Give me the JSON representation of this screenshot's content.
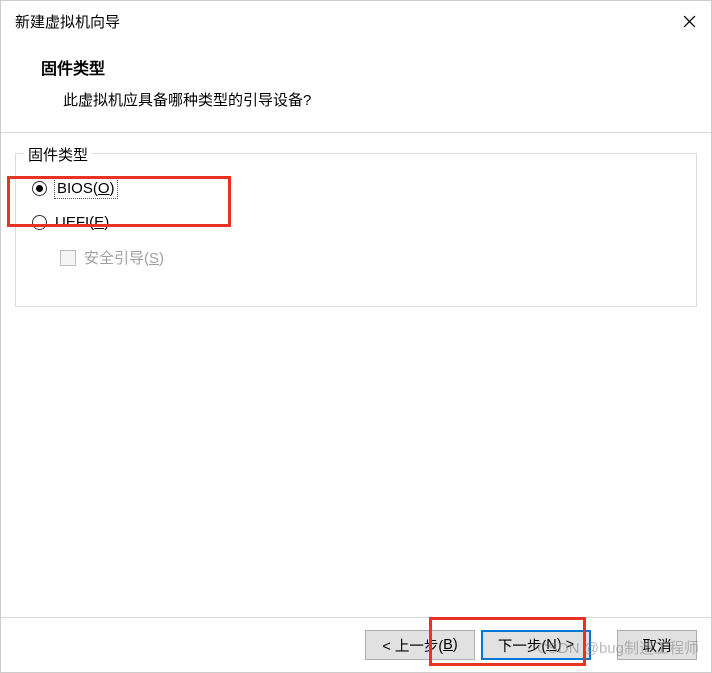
{
  "window": {
    "title": "新建虚拟机向导"
  },
  "header": {
    "heading": "固件类型",
    "subtext": "此虚拟机应具备哪种类型的引导设备?"
  },
  "group": {
    "legend": "固件类型",
    "options": {
      "bios": {
        "prefix": "BIOS(",
        "hotkey": "O",
        "suffix": ")",
        "selected": true
      },
      "uefi": {
        "prefix": "UEFI(",
        "hotkey": "E",
        "suffix": ")",
        "selected": false
      },
      "secureboot": {
        "prefix": "安全引导(",
        "hotkey": "S",
        "suffix": ")",
        "enabled": false
      }
    }
  },
  "buttons": {
    "back": {
      "prefix": "< 上一步(",
      "hotkey": "B",
      "suffix": ")"
    },
    "next": {
      "prefix": "下一步(",
      "hotkey": "N",
      "suffix": ") >"
    },
    "cancel": {
      "label": "取消"
    }
  },
  "watermark": "CSDN @bug制造工程师"
}
